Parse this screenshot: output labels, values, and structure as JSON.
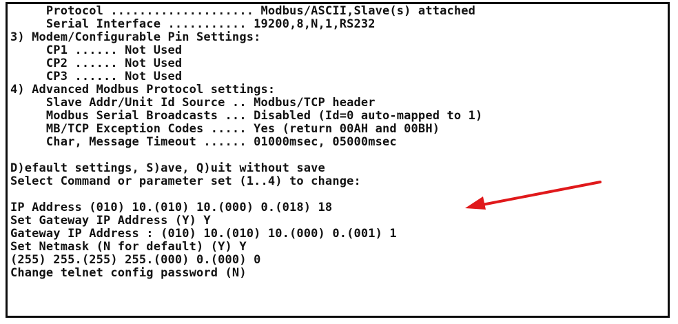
{
  "terminal": {
    "lines": [
      "     Protocol .................... Modbus/ASCII,Slave(s) attached",
      "     Serial Interface ........... 19200,8,N,1,RS232",
      "3) Modem/Configurable Pin Settings:",
      "     CP1 ...... Not Used",
      "     CP2 ...... Not Used",
      "     CP3 ...... Not Used",
      "4) Advanced Modbus Protocol settings:",
      "     Slave Addr/Unit Id Source .. Modbus/TCP header",
      "     Modbus Serial Broadcasts ... Disabled (Id=0 auto-mapped to 1)",
      "     MB/TCP Exception Codes ..... Yes (return 00AH and 00BH)",
      "     Char, Message Timeout ...... 01000msec, 05000msec",
      "D)efault settings, S)ave, Q)uit without save",
      "Select Command or parameter set (1..4) to change:",
      "IP Address (010) 10.(010) 10.(000) 0.(018) 18",
      "Set Gateway IP Address (Y) Y",
      "Gateway IP Address : (010) 10.(010) 10.(000) 0.(001) 1",
      "Set Netmask (N for default) (Y) Y",
      "(255) 255.(255) 255.(000) 0.(000) 0",
      "Change telnet config password (N)"
    ]
  },
  "annotation": {
    "arrow_color": "#e0191b"
  }
}
